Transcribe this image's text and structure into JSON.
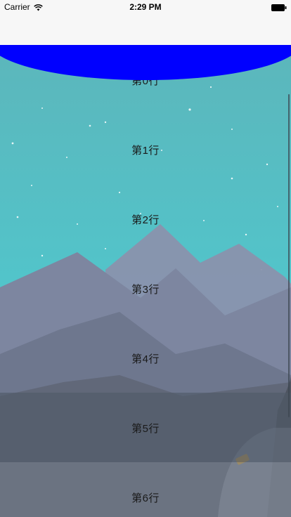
{
  "status_bar": {
    "carrier": "Carrier",
    "time": "2:29 PM"
  },
  "icons": {
    "wifi": "wifi-icon",
    "battery": "battery-icon"
  },
  "colors": {
    "header_ellipse": "#0000ff",
    "sky": "#4fc6cc",
    "mountains": "#7d86a0"
  },
  "table": {
    "rows": [
      "第0行",
      "第1行",
      "第2行",
      "第3行",
      "第4行",
      "第5行",
      "第6行"
    ]
  }
}
